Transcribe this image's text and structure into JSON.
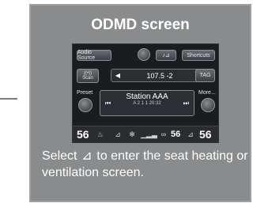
{
  "panel_title": "ODMD screen",
  "screen": {
    "audio_source_label": "Audio Source",
    "shortcuts_label": "Shortcuts",
    "scan_label": "Scan",
    "tag_label": "TAG",
    "frequency": "107.5 -2",
    "preset_label": "Preset",
    "more_label": "More...",
    "station_name": "Station AAA",
    "station_detail": "A  2  1  1  20:32",
    "driver_temp": "56",
    "passenger_temp": "56",
    "center_temp": "56"
  },
  "caption_before_icon": "Select",
  "caption_after_icon": "to enter the seat heating or ventilation screen.",
  "icons": [
    "seat-icon",
    "snowflake-icon",
    "left-arrow-icon",
    "right-arrow-icon",
    "seek-back-icon",
    "seek-forward-icon",
    "fan-icon"
  ]
}
